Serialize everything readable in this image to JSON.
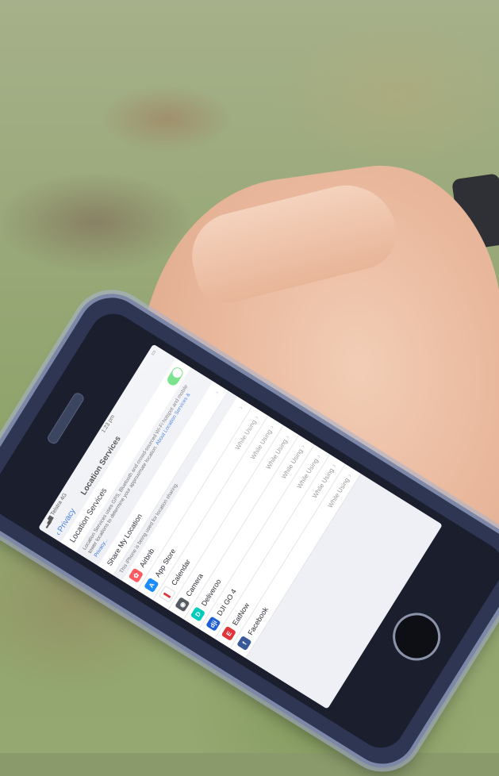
{
  "status_bar": {
    "carrier": "Telstra",
    "network": "4G",
    "time": "1:23 pm"
  },
  "nav": {
    "back_label": "Privacy",
    "title": "Location Services"
  },
  "location_services": {
    "label": "Location Services",
    "enabled": true,
    "description": "Location Services uses GPS, Bluetooth and crowd-sourced Wi-Fi hotspot and mobile tower locations to determine your approximate location.",
    "link_about": "About Location Services & Privacy..."
  },
  "share_my_location": {
    "label": "Share My Location",
    "note": "This iPhone is being used for location sharing."
  },
  "apps": [
    {
      "name": "Airbnb",
      "value": "",
      "icon": "airbnb-icon",
      "color": "#ff5a5f",
      "glyph": "✿"
    },
    {
      "name": "App Store",
      "value": "While Using",
      "icon": "app-store-icon",
      "color": "#1a8cff",
      "glyph": "A"
    },
    {
      "name": "Calendar",
      "value": "While Using",
      "icon": "calendar-icon",
      "color": "#ffffff",
      "glyph": "▌"
    },
    {
      "name": "Camera",
      "value": "While Using",
      "icon": "camera-icon",
      "color": "#555a63",
      "glyph": "◉"
    },
    {
      "name": "Deliveroo",
      "value": "While Using",
      "icon": "deliveroo-icon",
      "color": "#00ccbc",
      "glyph": "D"
    },
    {
      "name": "DJI GO 4",
      "value": "While Using",
      "icon": "dji-icon",
      "color": "#1f5fd6",
      "glyph": "dji"
    },
    {
      "name": "EatNow",
      "value": "While Using",
      "icon": "eatnow-icon",
      "color": "#e0353a",
      "glyph": "E"
    },
    {
      "name": "Facebook",
      "value": "While Using",
      "icon": "facebook-icon",
      "color": "#3b5998",
      "glyph": "f"
    }
  ]
}
